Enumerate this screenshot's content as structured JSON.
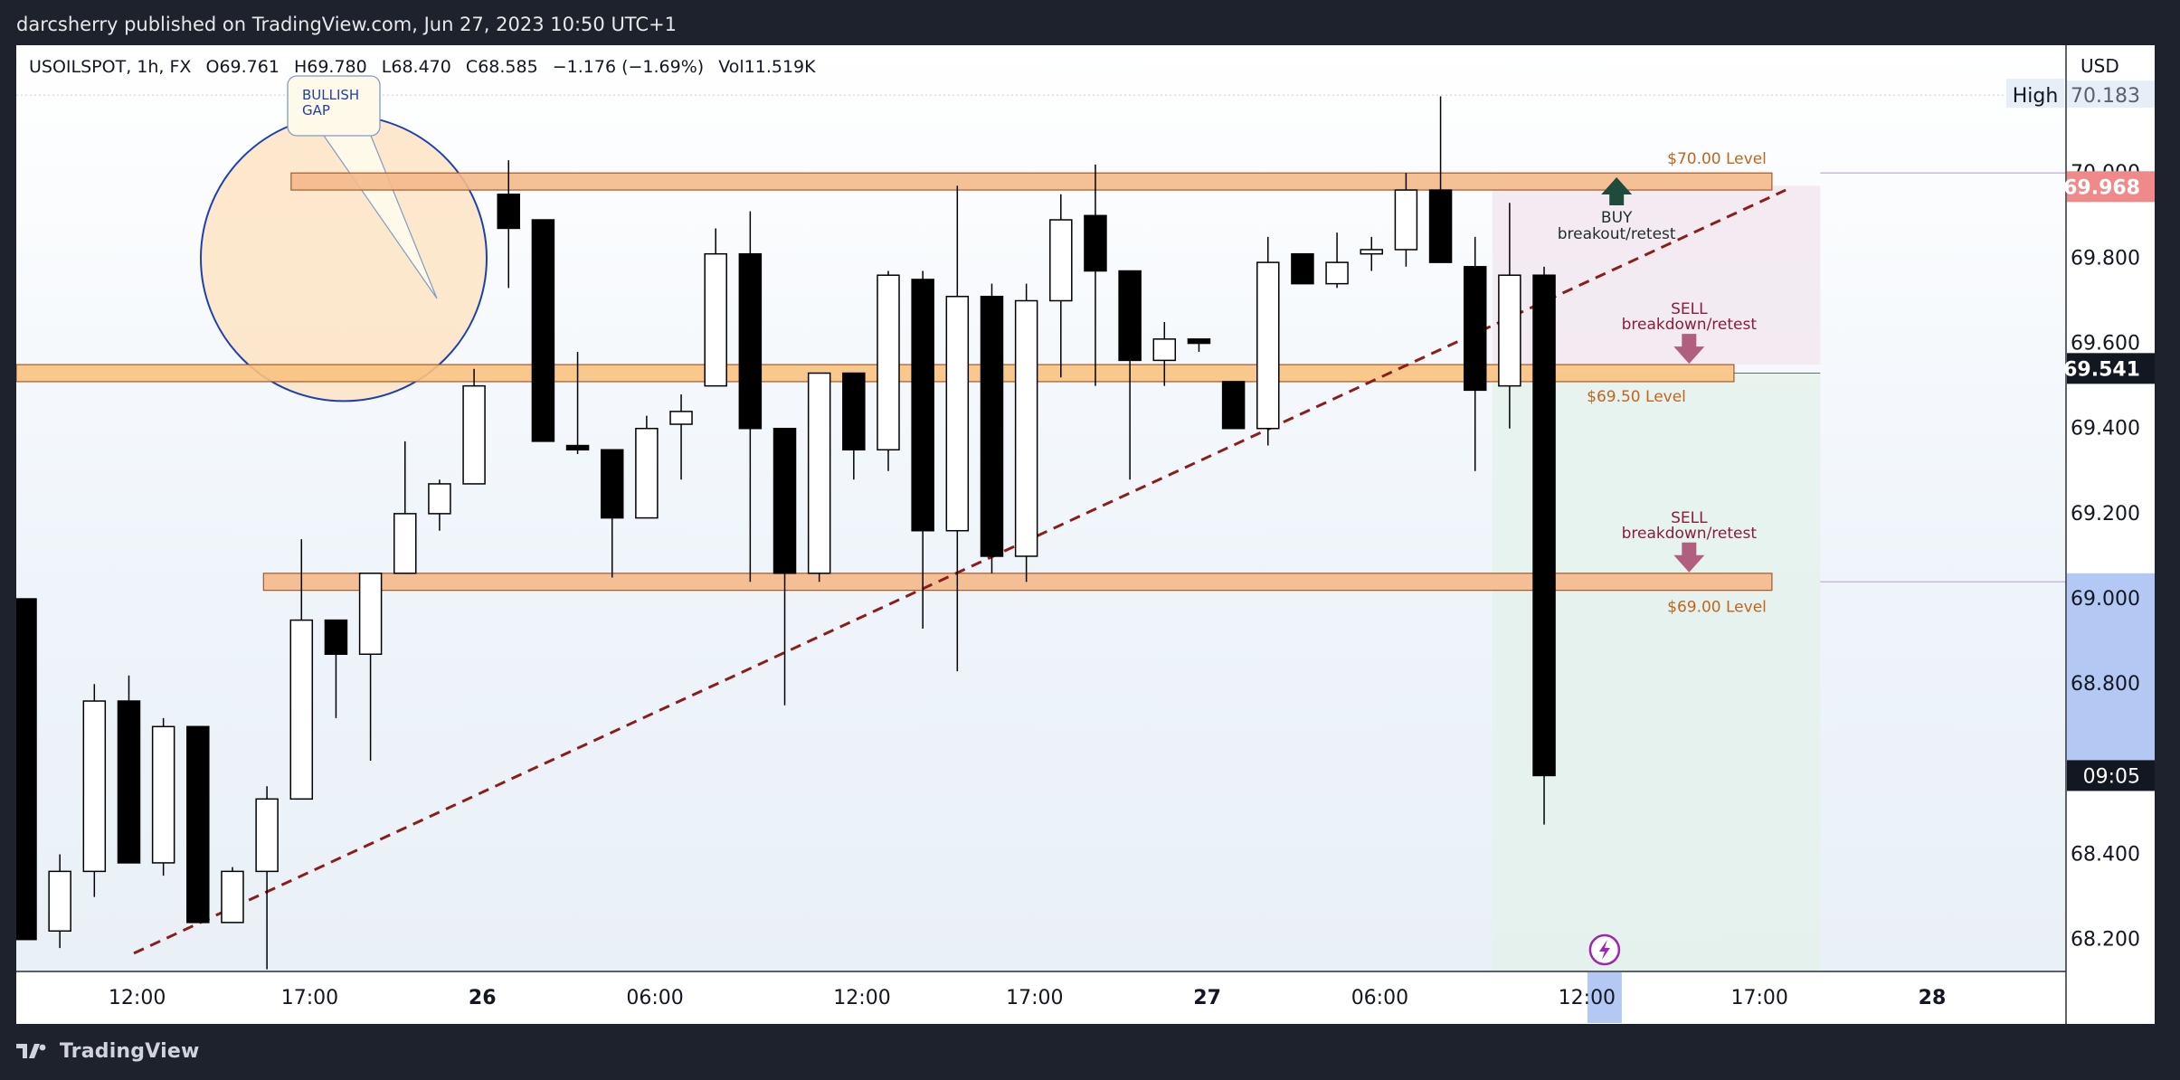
{
  "header": {
    "published_line": "darcsherry published on TradingView.com, Jun 27, 2023 10:50 UTC+1"
  },
  "legend": {
    "symbol": "USOILSPOT, 1h, FX",
    "open": "O69.761",
    "high": "H69.780",
    "low": "L68.470",
    "close": "C68.585",
    "change": "−1.176 (−1.69%)",
    "volume": "Vol11.519K"
  },
  "price_axis": {
    "currency": "USD",
    "high_label": "High",
    "high_value": "70.183",
    "price_tag": "69.968",
    "level_tag": "69.541",
    "countdown_tag": "09:05",
    "obscured_tick": "70.000"
  },
  "footer": {
    "brand": "TradingView"
  },
  "annotations": {
    "bullish_gap": "BULLISH\nGAP",
    "level_70": "$70.00 Level",
    "level_6950": "$69.50 Level",
    "level_69": "$69.00 Level",
    "buy": "BUY",
    "buy_sub": "breakout/retest",
    "sell": "SELL",
    "sell_sub": "breakdown/retest"
  },
  "colors": {
    "zone_fill": "#f5b98a",
    "zone_border": "#a35a2c",
    "mid_zone_fill": "#f9c27f",
    "trendline": "#8b1d1d",
    "buy_arrow": "#1f4a3c",
    "sell_arrow": "#b0607e",
    "level_label": "#c0651d",
    "circle_stroke": "#1e40af",
    "circle_fill": "#fde4c4",
    "price_tag": "#f08a8a"
  },
  "chart_data": {
    "type": "candlestick",
    "title": "",
    "ylim": [
      68.125,
      70.3
    ],
    "y_ticks": [
      68.2,
      68.4,
      68.6,
      68.8,
      69.0,
      69.2,
      69.4,
      69.6,
      69.8,
      70.0
    ],
    "x_ticks": [
      {
        "label": "12:00",
        "i": 4,
        "bold": false
      },
      {
        "label": "17:00",
        "i": 9,
        "bold": false
      },
      {
        "label": "26",
        "i": 14,
        "bold": true
      },
      {
        "label": "06:00",
        "i": 19,
        "bold": false
      },
      {
        "label": "12:00",
        "i": 25,
        "bold": false
      },
      {
        "label": "17:00",
        "i": 30,
        "bold": false
      },
      {
        "label": "27",
        "i": 35,
        "bold": true
      },
      {
        "label": "06:00",
        "i": 40,
        "bold": false
      },
      {
        "label": "12:00",
        "i": 46,
        "bold": false
      },
      {
        "label": "17:00",
        "i": 51,
        "bold": false
      },
      {
        "label": "28",
        "i": 56,
        "bold": true
      }
    ],
    "ohlc": [
      [
        69.0,
        69.0,
        68.2,
        68.2
      ],
      [
        68.22,
        68.4,
        68.18,
        68.36
      ],
      [
        68.36,
        68.8,
        68.3,
        68.76
      ],
      [
        68.76,
        68.82,
        68.38,
        68.38
      ],
      [
        68.38,
        68.72,
        68.35,
        68.7
      ],
      [
        68.7,
        68.7,
        68.24,
        68.24
      ],
      [
        68.24,
        68.37,
        68.24,
        68.36
      ],
      [
        68.36,
        68.56,
        68.13,
        68.53
      ],
      [
        68.53,
        69.14,
        68.53,
        68.95
      ],
      [
        68.95,
        68.95,
        68.72,
        68.87
      ],
      [
        68.87,
        69.06,
        68.62,
        69.06
      ],
      [
        69.06,
        69.37,
        69.06,
        69.2
      ],
      [
        69.2,
        69.28,
        69.16,
        69.27
      ],
      [
        69.27,
        69.54,
        69.27,
        69.5
      ],
      [
        69.95,
        70.03,
        69.73,
        69.87
      ],
      [
        69.89,
        69.89,
        69.37,
        69.37
      ],
      [
        69.36,
        69.58,
        69.34,
        69.35
      ],
      [
        69.35,
        69.35,
        69.05,
        69.19
      ],
      [
        69.19,
        69.43,
        69.19,
        69.4
      ],
      [
        69.41,
        69.48,
        69.28,
        69.44
      ],
      [
        69.5,
        69.87,
        69.5,
        69.81
      ],
      [
        69.81,
        69.91,
        69.04,
        69.4
      ],
      [
        69.4,
        69.4,
        68.75,
        69.06
      ],
      [
        69.06,
        69.53,
        69.04,
        69.53
      ],
      [
        69.53,
        69.53,
        69.28,
        69.35
      ],
      [
        69.35,
        69.77,
        69.3,
        69.76
      ],
      [
        69.75,
        69.77,
        68.93,
        69.16
      ],
      [
        69.16,
        69.97,
        68.83,
        69.71
      ],
      [
        69.71,
        69.74,
        69.06,
        69.1
      ],
      [
        69.1,
        69.74,
        69.04,
        69.7
      ],
      [
        69.7,
        69.95,
        69.52,
        69.89
      ],
      [
        69.9,
        70.02,
        69.5,
        69.77
      ],
      [
        69.77,
        69.77,
        69.28,
        69.56
      ],
      [
        69.56,
        69.65,
        69.5,
        69.61
      ],
      [
        69.61,
        69.61,
        69.58,
        69.6
      ],
      [
        69.51,
        69.51,
        69.4,
        69.4
      ],
      [
        69.4,
        69.85,
        69.36,
        69.79
      ],
      [
        69.81,
        69.81,
        69.74,
        69.74
      ],
      [
        69.74,
        69.86,
        69.73,
        69.79
      ],
      [
        69.81,
        69.85,
        69.77,
        69.82
      ],
      [
        69.82,
        70.0,
        69.78,
        69.96
      ],
      [
        69.96,
        70.18,
        69.8,
        69.79
      ],
      [
        69.78,
        69.85,
        69.3,
        69.49
      ],
      [
        69.5,
        69.93,
        69.4,
        69.76
      ],
      [
        69.76,
        69.78,
        68.47,
        68.585
      ]
    ],
    "levels": [
      {
        "name": "$70.00 Level",
        "from": 69.96,
        "to": 70.0
      },
      {
        "name": "$69.50 Level",
        "from": 69.51,
        "to": 69.55
      },
      {
        "name": "$69.00 Level",
        "from": 69.02,
        "to": 69.06
      }
    ],
    "trendline": {
      "from": [
        0,
        68.05
      ],
      "to": [
        51,
        69.96
      ]
    }
  }
}
